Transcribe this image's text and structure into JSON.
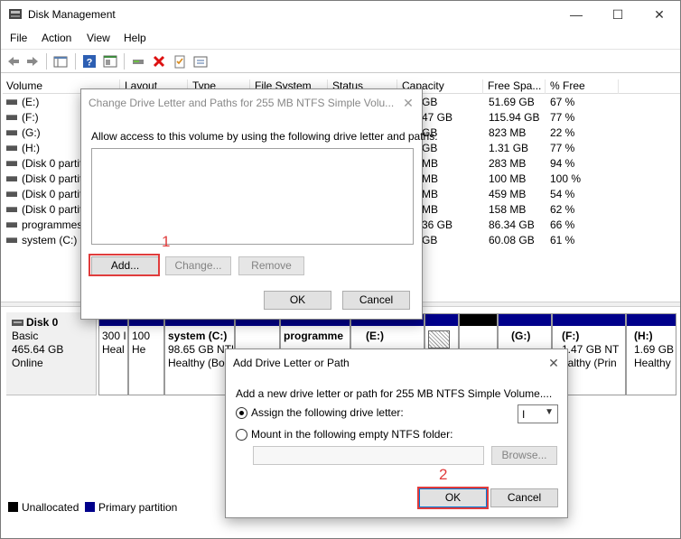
{
  "window": {
    "title": "Disk Management",
    "minimize": "—",
    "maximize": "☐",
    "close": "✕"
  },
  "menu": [
    "File",
    "Action",
    "View",
    "Help"
  ],
  "volume_list": {
    "columns": [
      "Volume",
      "Layout",
      "Type",
      "File System",
      "Status",
      "Capacity",
      "Free Spa...",
      "% Free"
    ],
    "rows": [
      {
        "name": "(E:)",
        "capacity": "GB",
        "free": "51.69 GB",
        "pct": "67 %"
      },
      {
        "name": "(F:)",
        "capacity": "47 GB",
        "free": "115.94 GB",
        "pct": "77 %"
      },
      {
        "name": "(G:)",
        "capacity": "GB",
        "free": "823 MB",
        "pct": "22 %"
      },
      {
        "name": "(H:)",
        "capacity": "GB",
        "free": "1.31 GB",
        "pct": "77 %"
      },
      {
        "name": "(Disk 0 partit",
        "capacity": "MB",
        "free": "283 MB",
        "pct": "94 %"
      },
      {
        "name": "(Disk 0 partit",
        "capacity": "MB",
        "free": "100 MB",
        "pct": "100 %"
      },
      {
        "name": "(Disk 0 partit",
        "capacity": "MB",
        "free": "459 MB",
        "pct": "54 %"
      },
      {
        "name": "(Disk 0 partit",
        "capacity": "MB",
        "free": "158 MB",
        "pct": "62 %"
      },
      {
        "name": "programmes",
        "capacity": "36 GB",
        "free": "86.34 GB",
        "pct": "66 %"
      },
      {
        "name": "system (C:)",
        "capacity": "GB",
        "free": "60.08 GB",
        "pct": "61 %"
      }
    ]
  },
  "disk": {
    "name": "Disk 0",
    "type": "Basic",
    "size": "465.64 GB",
    "status": "Online"
  },
  "partitions": [
    {
      "l1": "300 I",
      "l2": "Heal"
    },
    {
      "l1": "100",
      "l2": "He"
    },
    {
      "title": "system  (C:)",
      "l1": "98.65 GB NTFS",
      "l2": "Healthy (Bo"
    },
    {
      "title": "programme",
      "l1": "",
      "l2": ""
    },
    {
      "title": "(E:)",
      "l1": "",
      "l2": ""
    },
    {
      "title": "(G:)",
      "l1": "",
      "l2": ""
    },
    {
      "title": "(F:)",
      "l1": "1.47 GB NT",
      "l2": "ealthy (Prin"
    },
    {
      "title": "(H:)",
      "l1": "1.69 GB",
      "l2": "Healthy"
    }
  ],
  "legend": {
    "unallocated": "Unallocated",
    "primary": "Primary partition"
  },
  "dialog_change": {
    "title": "Change Drive Letter and Paths for 255 MB NTFS Simple Volu...",
    "close": "✕",
    "instruction": "Allow access to this volume by using the following drive letter and paths:",
    "add": "Add...",
    "change": "Change...",
    "remove": "Remove",
    "ok": "OK",
    "cancel": "Cancel",
    "step": "1"
  },
  "dialog_add": {
    "title": "Add Drive Letter or Path",
    "close": "✕",
    "instruction": "Add a new drive letter or path for 255 MB NTFS Simple Volume....",
    "assign_label": "Assign the following drive letter:",
    "assign_checked": true,
    "drive_letter": "I",
    "mount_label": "Mount in the following empty NTFS folder:",
    "browse": "Browse...",
    "ok": "OK",
    "cancel": "Cancel",
    "step": "2"
  },
  "colors": {
    "primary_partition": "#00008b",
    "unallocated": "#000000",
    "highlight": "#e03c3c"
  }
}
